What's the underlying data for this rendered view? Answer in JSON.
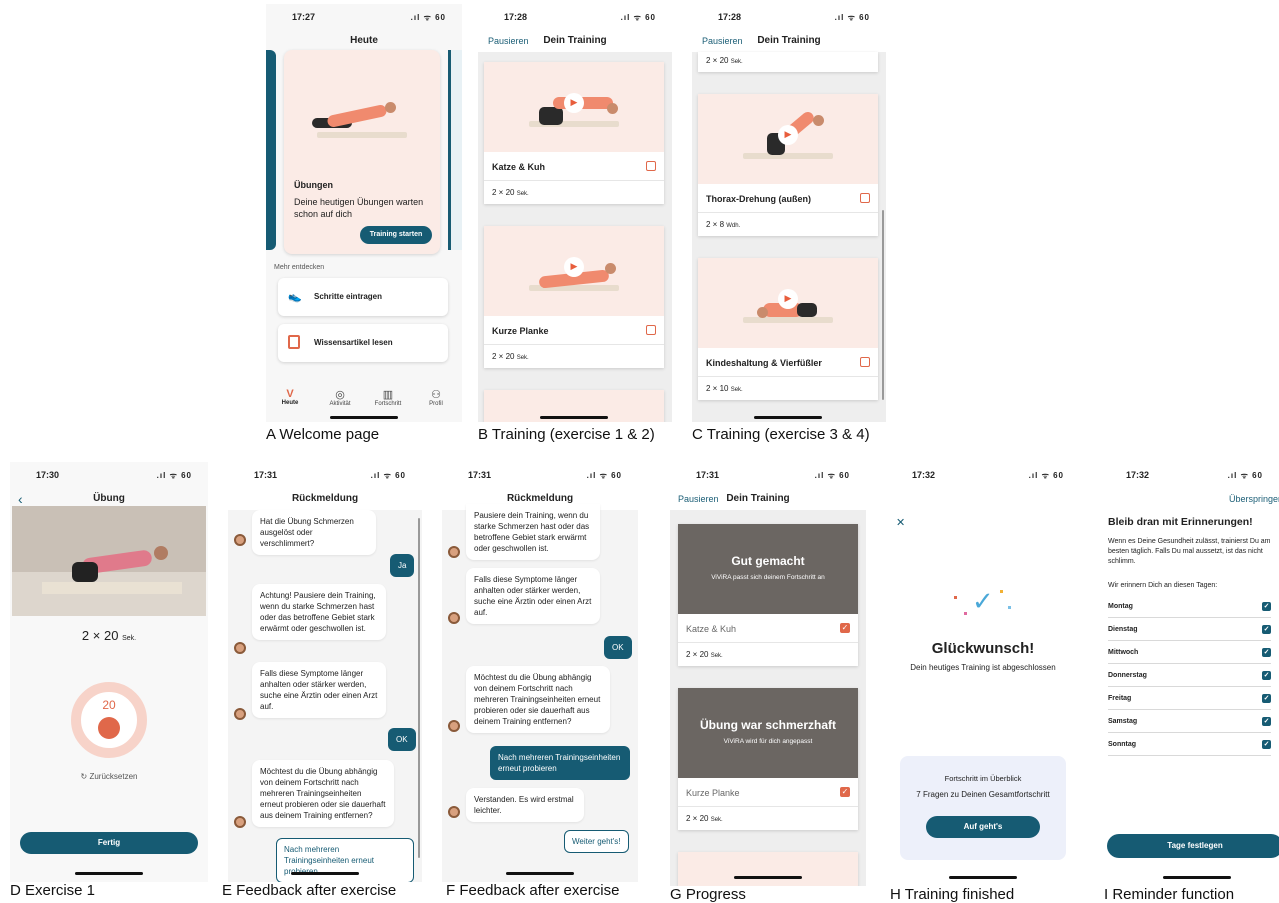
{
  "captions": {
    "a": "A Welcome page",
    "b": "B Training (exercise 1 & 2)",
    "c": "C Training (exercise 3 & 4)",
    "d": "D Exercise 1",
    "e": "E Feedback after exercise",
    "f": "F Feedback after exercise",
    "g": "G Progress",
    "h": "H Training finished",
    "i": "I Reminder function"
  },
  "status": {
    "a": "17:27",
    "b": "17:28",
    "c": "17:28",
    "d": "17:30",
    "e": "17:31",
    "f": "17:31",
    "g": "17:31",
    "h": "17:32",
    "i": "17:32",
    "icons": ".ıl ᯤ 60"
  },
  "screen_a": {
    "title": "Heute",
    "card_heading": "Übungen",
    "card_text": "Deine heutigen Übungen warten schon auf dich",
    "start_button": "Training starten",
    "more_label": "Mehr entdecken",
    "link1": "Schritte eintragen",
    "link2": "Wissensartikel lesen",
    "tabs": [
      {
        "icon": "V",
        "label": "Heute"
      },
      {
        "icon": "◎",
        "label": "Aktivität"
      },
      {
        "icon": "▥",
        "label": "Fortschritt"
      },
      {
        "icon": "⚇",
        "label": "Profil"
      }
    ]
  },
  "screen_b": {
    "pause": "Pausieren",
    "title": "Dein Training",
    "ex1": "Katze & Kuh",
    "ex1_rep": "2 × 20",
    "ex2": "Kurze Planke",
    "ex2_rep": "2 × 20",
    "unit_sek": "Sek."
  },
  "screen_c": {
    "pause": "Pausieren",
    "title": "Dein Training",
    "top_rep": "2 × 20",
    "ex3": "Thorax-Drehung (außen)",
    "ex3_rep": "2 × 8",
    "unit_wdh": "Wdh.",
    "ex4": "Kindeshaltung & Vierfüßler",
    "ex4_rep": "2 × 10",
    "unit_sek": "Sek."
  },
  "screen_d": {
    "title": "Übung",
    "reps": "2 × 20",
    "unit": "Sek.",
    "timer": "20",
    "reset": "Zurücksetzen",
    "done": "Fertig"
  },
  "screen_e": {
    "title": "Rückmeldung",
    "q1": "Hat die Übung Schmerzen ausgelöst oder verschlimmert?",
    "a1": "Ja",
    "m1": "Achtung! Pausiere dein Training, wenn du starke Schmerzen hast oder das betroffene Gebiet stark erwärmt oder geschwollen ist.",
    "m2": "Falls diese Symptome länger anhalten oder stärker werden, suche eine Ärztin oder einen Arzt auf.",
    "a2": "OK",
    "q2": "Möchtest du die Übung abhängig von deinem Fortschritt nach mehreren Trainingseinheiten erneut probieren oder sie dauerhaft aus deinem Training entfernen?",
    "opt": "Nach mehreren Trainingseinheiten erneut probieren"
  },
  "screen_f": {
    "title": "Rückmeldung",
    "m1": "Pausiere dein Training, wenn du starke Schmerzen hast oder das betroffene Gebiet stark erwärmt oder geschwollen ist.",
    "m2": "Falls diese Symptome länger anhalten oder stärker werden, suche eine Ärztin oder einen Arzt auf.",
    "a1": "OK",
    "q2": "Möchtest du die Übung abhängig von deinem Fortschritt nach mehreren Trainingseinheiten erneut probieren oder sie dauerhaft aus deinem Training entfernen?",
    "a2": "Nach mehreren Trainingseinheiten erneut probieren",
    "m3": "Verstanden. Es wird erstmal leichter.",
    "next": "Weiter geht's!"
  },
  "screen_g": {
    "pause": "Pausieren",
    "title": "Dein Training",
    "ov1_title": "Gut gemacht",
    "ov1_sub": "ViViRA passt sich deinem Fortschritt an",
    "ex1": "Katze & Kuh",
    "ex1_rep": "2 × 20",
    "ov2_title": "Übung war schmerzhaft",
    "ov2_sub": "ViViRA wird für dich angepasst",
    "ex2": "Kurze Planke",
    "ex2_rep": "2 × 20",
    "unit_sek": "Sek."
  },
  "screen_h": {
    "close": "✕",
    "title": "Glückwunsch!",
    "sub": "Dein heutiges Training ist abgeschlossen",
    "box_title": "Fortschritt im Überblick",
    "box_text": "7 Fragen zu Deinen Gesamtfortschritt",
    "box_button": "Auf geht's"
  },
  "screen_i": {
    "skip": "Überspringen",
    "title": "Bleib dran mit Erinnerungen!",
    "text": "Wenn es Deine Gesundheit zulässt, trainierst Du am besten täglich. Falls Du mal aussetzt, ist das nicht schlimm.",
    "sub": "Wir erinnern Dich an diesen Tagen:",
    "days": [
      "Montag",
      "Dienstag",
      "Mittwoch",
      "Donnerstag",
      "Freitag",
      "Samstag",
      "Sonntag"
    ],
    "button": "Tage festlegen"
  },
  "colors": {
    "primary": "#165b73",
    "accent": "#e0684a",
    "card_bg": "#fbebe6"
  }
}
